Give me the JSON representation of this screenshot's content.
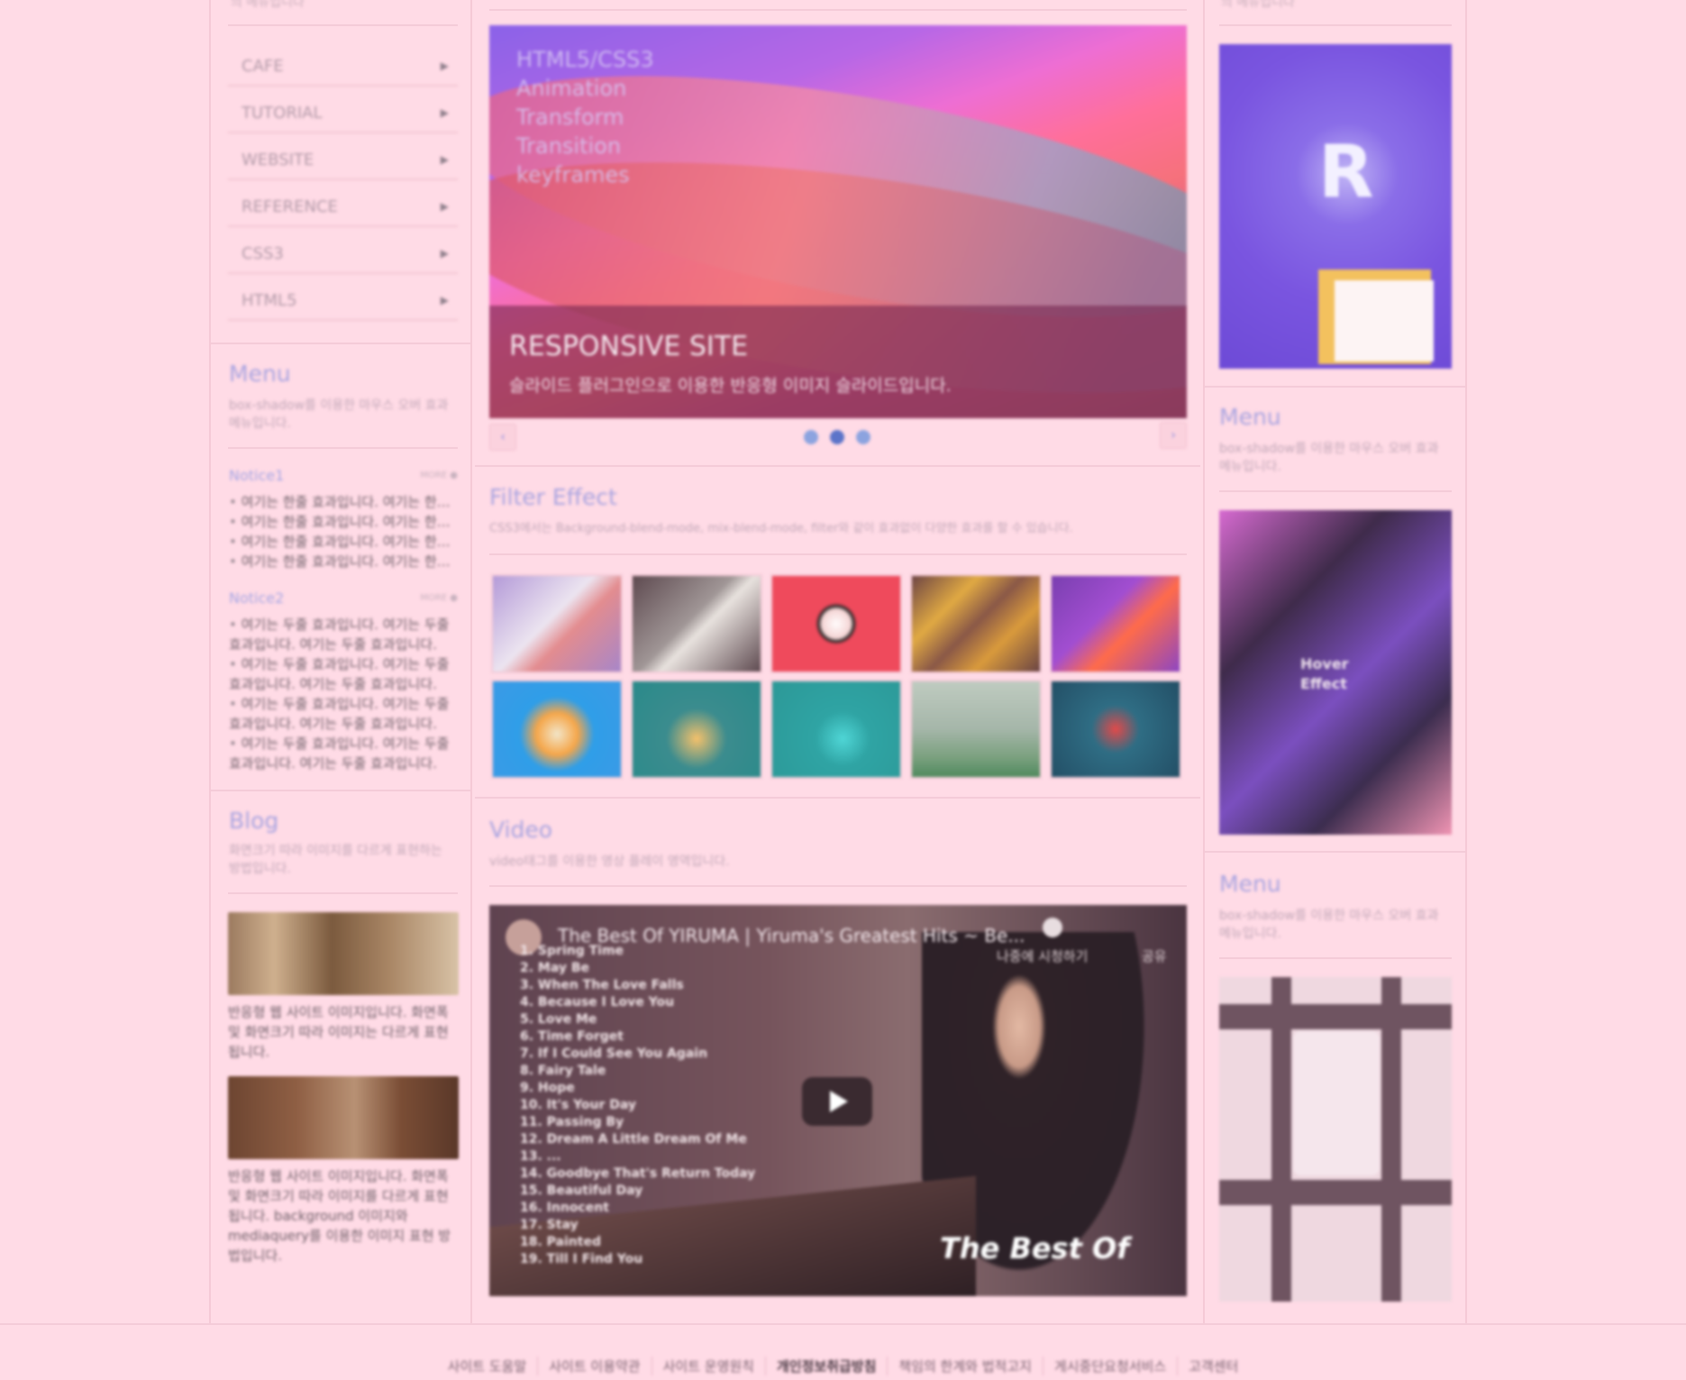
{
  "left": {
    "top_text": "의 메뉴입니다",
    "nav_items": [
      {
        "label": "CAFE",
        "arrow": "▶"
      },
      {
        "label": "TUTORIAL",
        "arrow": "▶"
      },
      {
        "label": "WEBSITE",
        "arrow": "▶"
      },
      {
        "label": "REFERENCE",
        "arrow": "▶"
      },
      {
        "label": "CSS3",
        "arrow": "▶"
      },
      {
        "label": "HTML5",
        "arrow": "▶"
      }
    ],
    "menu": {
      "title": "Menu",
      "desc": "box-shadow를 이용한 마우스 오버 효과 메뉴입니다."
    },
    "notice1": {
      "title": "Notice1",
      "more": "MORE ●",
      "items": [
        "여기는 한줄 효과입니다. 여기는 한줄 효과입니다.",
        "여기는 한줄 효과입니다. 여기는 한줄 효과입니다.",
        "여기는 한줄 효과입니다. 여기는 한줄 효과입니다.",
        "여기는 한줄 효과입니다. 여기는 한줄 효과입니다."
      ]
    },
    "notice2": {
      "title": "Notice2",
      "more": "MORE ●",
      "items": [
        "여기는 두줄 효과입니다. 여기는 두줄 효과입니다. 여기는 두줄 효과입니다.",
        "여기는 두줄 효과입니다. 여기는 두줄 효과입니다. 여기는 두줄 효과입니다.",
        "여기는 두줄 효과입니다. 여기는 두줄 효과입니다. 여기는 두줄 효과입니다.",
        "여기는 두줄 효과입니다. 여기는 두줄 효과입니다. 여기는 두줄 효과입니다."
      ]
    },
    "blog": {
      "title": "Blog",
      "desc": "화면크기 따라 이미지를 다르게 표현하는 방법입니다.",
      "post1": "반응형 웹 사이트 이미지입니다. 화면폭 및 화면크기 따라 이미지는 다르게 표현됩니다.",
      "post2": "반응형 웹 사이트 이미지입니다. 화면폭 및 화면크기 따라 이미지를 다르게 표현됩니다. background 이미지와 mediaquery를 이용한 이미지 표현 방법입니다."
    }
  },
  "slider": {
    "list": [
      "HTML5/CSS3",
      "Animation",
      "Transform",
      "Transition",
      "keyframes"
    ],
    "caption_title": "RESPONSIVE SITE",
    "caption_desc": "슬라이드 플러그인으로 이용한 반응형 이미지 슬라이드입니다.",
    "prev": "‹",
    "next": "›",
    "active_dot": 2
  },
  "filter": {
    "title": "Filter Effect",
    "desc": "CSS3에서는 Background-blend-mode, mix-blend-mode, filter와 같이 효과없이 다양한 효과를 할 수 있습니다."
  },
  "video": {
    "title": "Video",
    "desc": "video태그를 이용한 영상 플레이 영역입니다.",
    "player_title": "The Best Of YIRUMA | Yiruma's Greatest Hits ~ Be...",
    "watch_later": "나중에 시청하기",
    "share": "공유",
    "brand": "The Best Of",
    "tracklist": [
      "1. Spring Time",
      "2. May Be",
      "3. When The Love Falls",
      "4. Because I Love You",
      "5. Love Me",
      "6. Time Forget",
      "7. If I Could See You Again",
      "8. Fairy Tale",
      "9. Hope",
      "10. It's Your Day",
      "11. Passing By",
      "12. Dream A Little Dream Of Me",
      "13. ...",
      "14. Goodbye That's Return Today",
      "15. Beautiful Day",
      "16. Innocent",
      "17. Stay",
      "18. Painted",
      "19. Till I Find You"
    ]
  },
  "right": {
    "top_text": "의 메뉴입니다",
    "menu1": {
      "title": "Menu",
      "desc": "box-shadow를 이용한 마우스 오버 효과 메뉴입니다."
    },
    "menu2": {
      "title": "Menu",
      "desc": "box-shadow를 이용한 마우스 오버 효과 메뉴입니다."
    },
    "hover_text": "Hover Effect"
  },
  "footer": {
    "links": [
      "사이트 도움말",
      "사이트 이용약관",
      "사이트 운영원칙",
      "개인정보취급방침",
      "책임의 한계와 법적고지",
      "게시중단요청서비스",
      "고객센터"
    ],
    "strong_index": 3
  }
}
